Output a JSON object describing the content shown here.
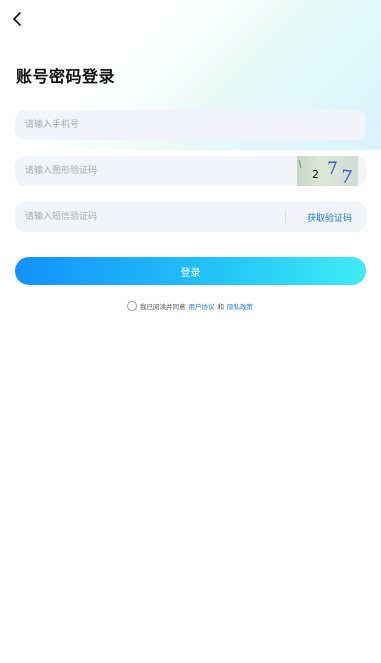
{
  "header": {
    "back_icon": "chevron-left-icon",
    "title": "账号密码登录"
  },
  "form": {
    "phone_placeholder": "请输入手机号",
    "captcha_placeholder": "请输入图形验证码",
    "captcha_text": "277",
    "sms_placeholder": "请输入短信验证码",
    "sms_button_label": "获取验证码"
  },
  "login_button_label": "登录",
  "agreement": {
    "prefix": "我已阅读并同意",
    "user_agreement": "用户协议",
    "and": "和",
    "privacy_policy": "隐私政策",
    "checked": false
  },
  "colors": {
    "accent_blue": "#1a7de0",
    "button_gradient_start": "#1291fb",
    "button_gradient_end": "#40ebf5",
    "field_bg": "#f3f4f9"
  }
}
